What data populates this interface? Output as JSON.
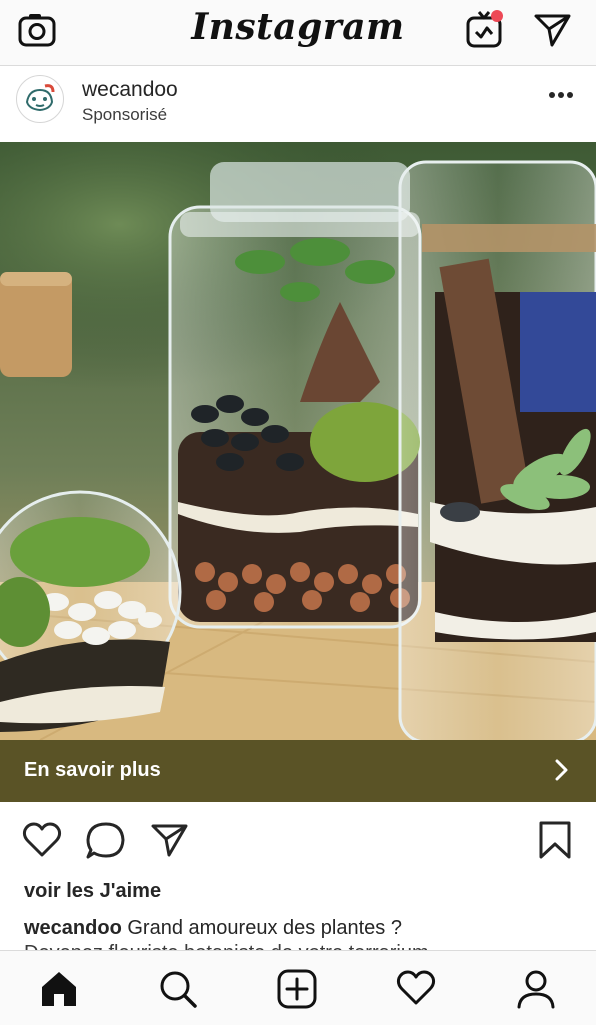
{
  "app": {
    "title": "Instagram"
  },
  "topbar": {
    "camera_icon": "camera-icon",
    "igtv_icon": "igtv-icon",
    "igtv_badge_color": "#ed4956",
    "direct_icon": "direct-send-icon"
  },
  "post": {
    "username": "wecandoo",
    "subtitle": "Sponsorisé",
    "more_icon": "more-horizontal-icon",
    "cta_label": "En savoir plus",
    "cta_color": "#5a5326",
    "likes_text": "voir les J'aime",
    "caption_user": "wecandoo",
    "caption_text": "Grand amoureux des plantes ?",
    "caption_next_line": "Devenez fleuriste botaniste de votre terrarium",
    "actions": [
      "heart-icon",
      "comment-icon",
      "share-icon",
      "bookmark-icon"
    ]
  },
  "bottom_nav": {
    "items": [
      "home-icon",
      "search-icon",
      "new-post-icon",
      "activity-heart-icon",
      "profile-icon"
    ]
  }
}
